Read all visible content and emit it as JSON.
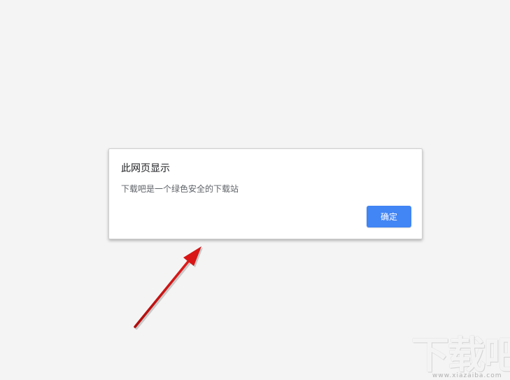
{
  "dialog": {
    "title": "此网页显示",
    "message": "下载吧是一个绿色安全的下载站",
    "ok_label": "确定"
  },
  "watermark": {
    "logo_text": "下载吧",
    "url": "www.xiazaiba.com"
  },
  "colors": {
    "page_background": "#f4f4f4",
    "button": "#4285f4",
    "arrow": "#d21414"
  },
  "annotation": {
    "type": "arrow",
    "points_to": "dialog"
  }
}
